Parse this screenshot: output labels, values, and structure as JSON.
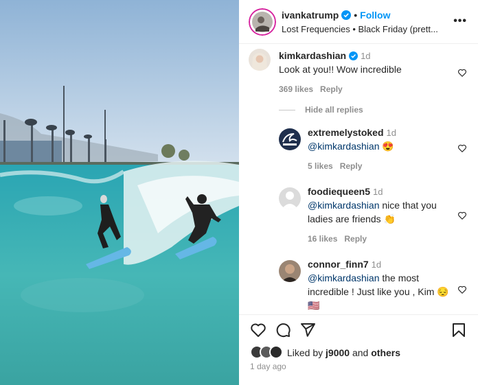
{
  "post": {
    "author": "ivankatrump",
    "follow_label": "Follow",
    "audio": "Lost Frequencies • Black Friday (prett...",
    "more_label": "•••",
    "liked_prefix": "Liked by ",
    "liked_user": "j9000",
    "liked_and": " and ",
    "liked_others": "others",
    "date": "1 day ago"
  },
  "comments": [
    {
      "user": "kimkardashian",
      "time": "1d",
      "mention": "",
      "text": "Look at you!! Wow incredible",
      "likes": "369 likes",
      "reply_label": "Reply"
    }
  ],
  "hide_replies_label": "Hide all replies",
  "replies": [
    {
      "user": "extremelystoked",
      "time": "1d",
      "mention": "@kimkardashian",
      "text": " 😍",
      "likes": "5 likes",
      "reply_label": "Reply"
    },
    {
      "user": "foodiequeen5",
      "time": "1d",
      "mention": "@kimkardashian",
      "text": " nice that you ladies are friends 👏",
      "likes": "16 likes",
      "reply_label": "Reply"
    },
    {
      "user": "connor_finn7",
      "time": "1d",
      "mention": "@kimkardashian",
      "text": " the most incredible ! Just like you , Kim 😔 🇺🇸",
      "likes": "",
      "reply_label": ""
    }
  ],
  "colors": {
    "accent": "#0095f6",
    "verified": "#0095f6",
    "mention": "#00376b",
    "muted": "#8e8e8e"
  },
  "icons": [
    "heart-icon",
    "comment-icon",
    "share-icon",
    "bookmark-icon",
    "verified-icon",
    "more-icon"
  ]
}
